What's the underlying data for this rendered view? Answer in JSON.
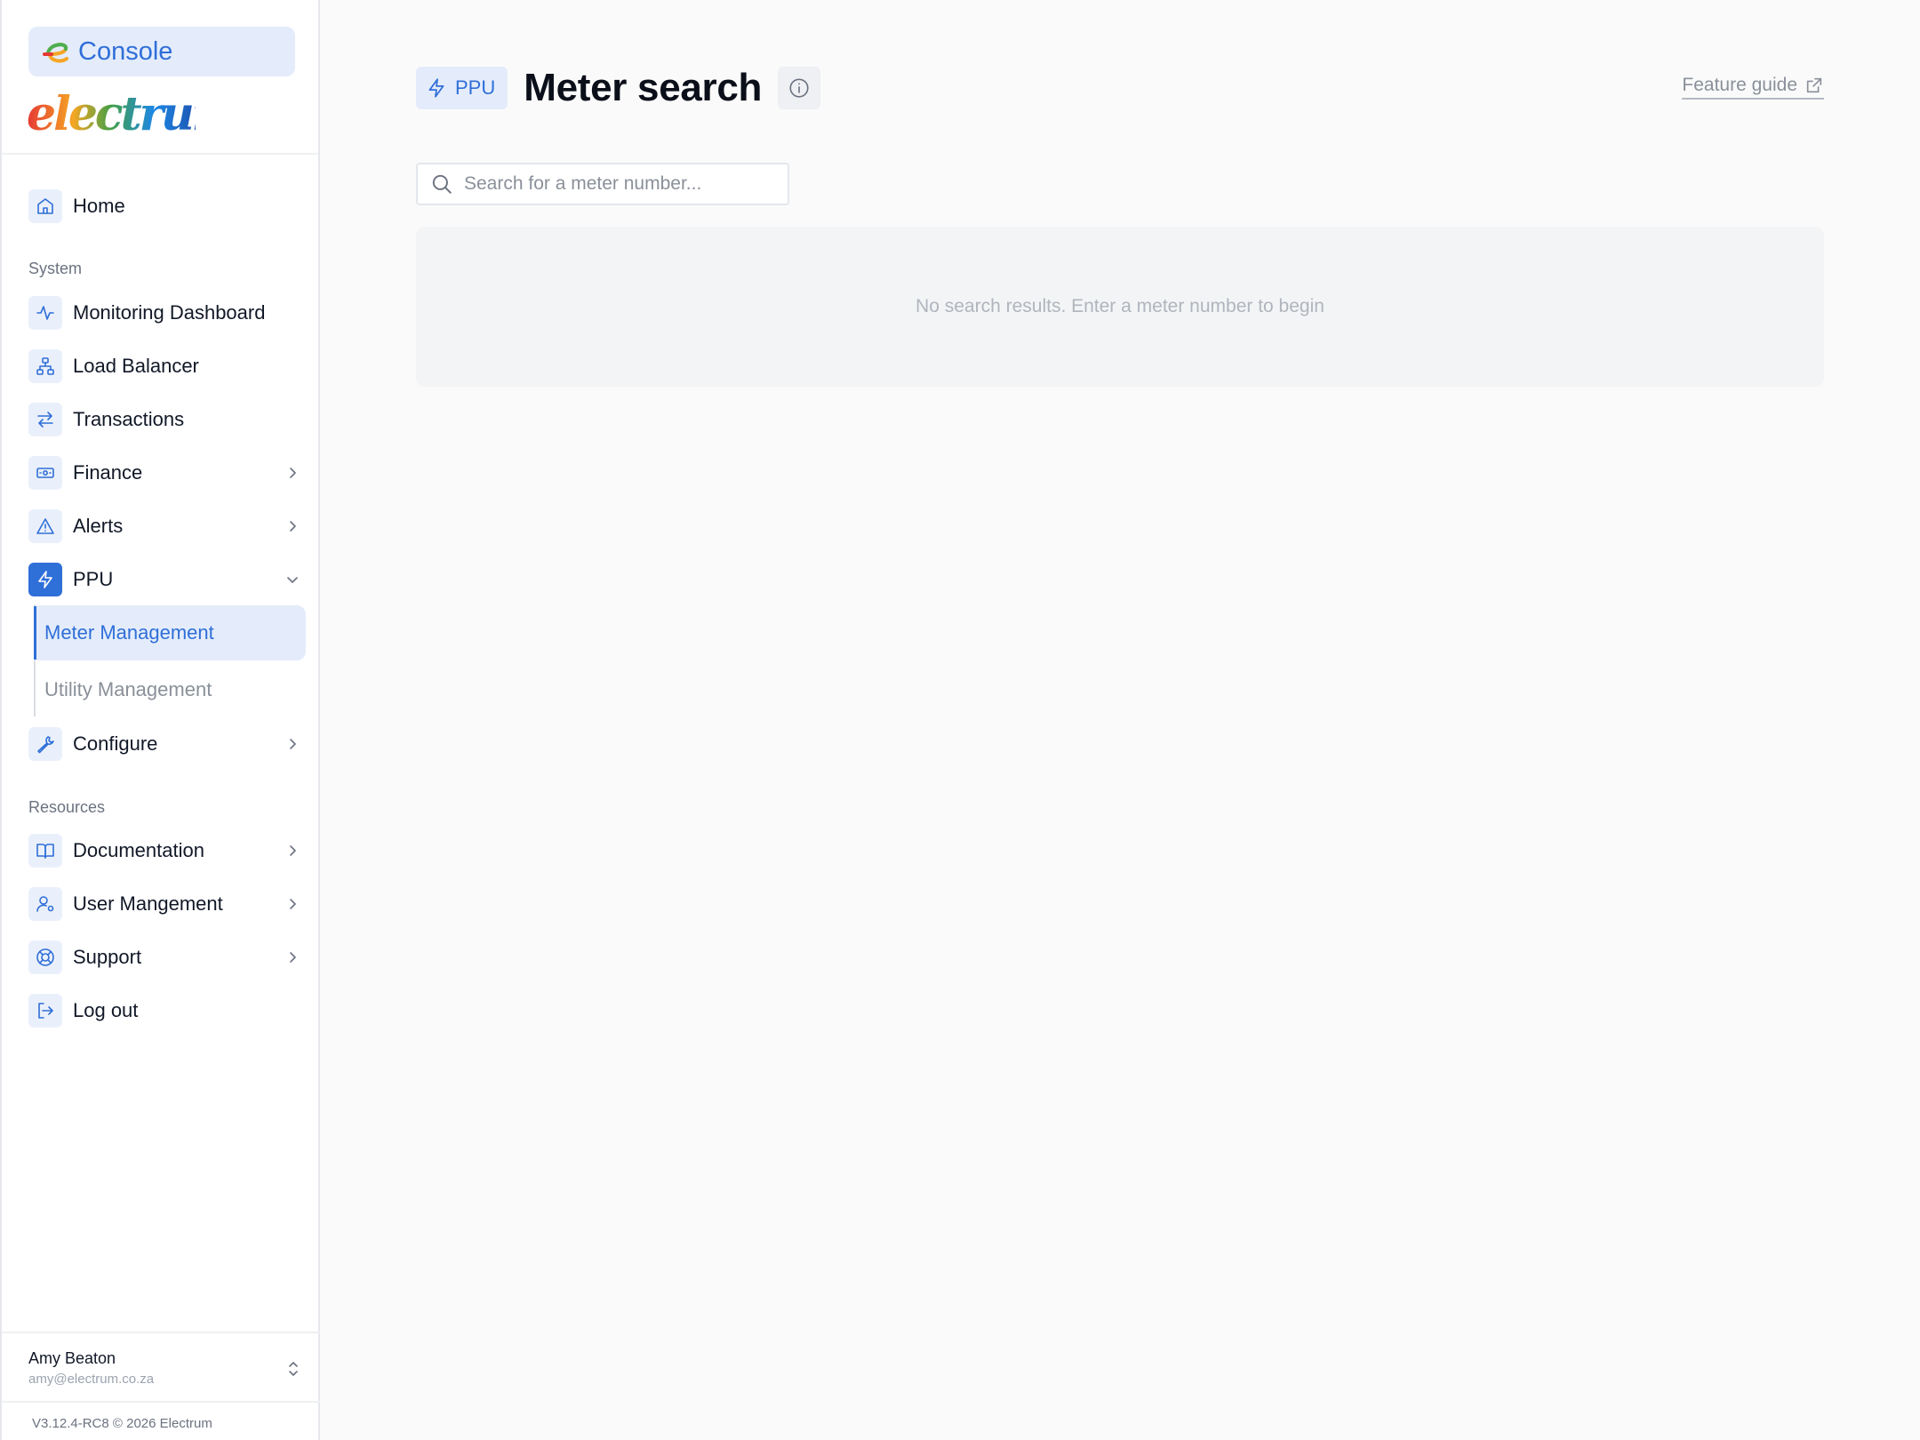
{
  "brand": {
    "console_label": "Console",
    "wordmark": "electrum"
  },
  "nav": {
    "home": "Home",
    "section_system": "System",
    "monitoring": "Monitoring Dashboard",
    "load_balancer": "Load Balancer",
    "transactions": "Transactions",
    "finance": "Finance",
    "alerts": "Alerts",
    "ppu": "PPU",
    "ppu_sub": [
      "Meter Management",
      "Utility Management"
    ],
    "configure": "Configure",
    "section_resources": "Resources",
    "documentation": "Documentation",
    "user_management": "User Mangement",
    "support": "Support",
    "logout": "Log out"
  },
  "user": {
    "name": "Amy Beaton",
    "email": "amy@electrum.co.za"
  },
  "version": "V3.12.4-RC8 © 2026 Electrum",
  "header": {
    "badge": "PPU",
    "title": "Meter search",
    "feature_guide": "Feature guide"
  },
  "search": {
    "placeholder": "Search for a meter number...",
    "value": ""
  },
  "results": {
    "empty_text": "No search results. Enter a meter number to begin"
  },
  "colors": {
    "accent": "#2f6fd8",
    "accent_light": "#e4ecfb",
    "background": "#fafafa"
  }
}
